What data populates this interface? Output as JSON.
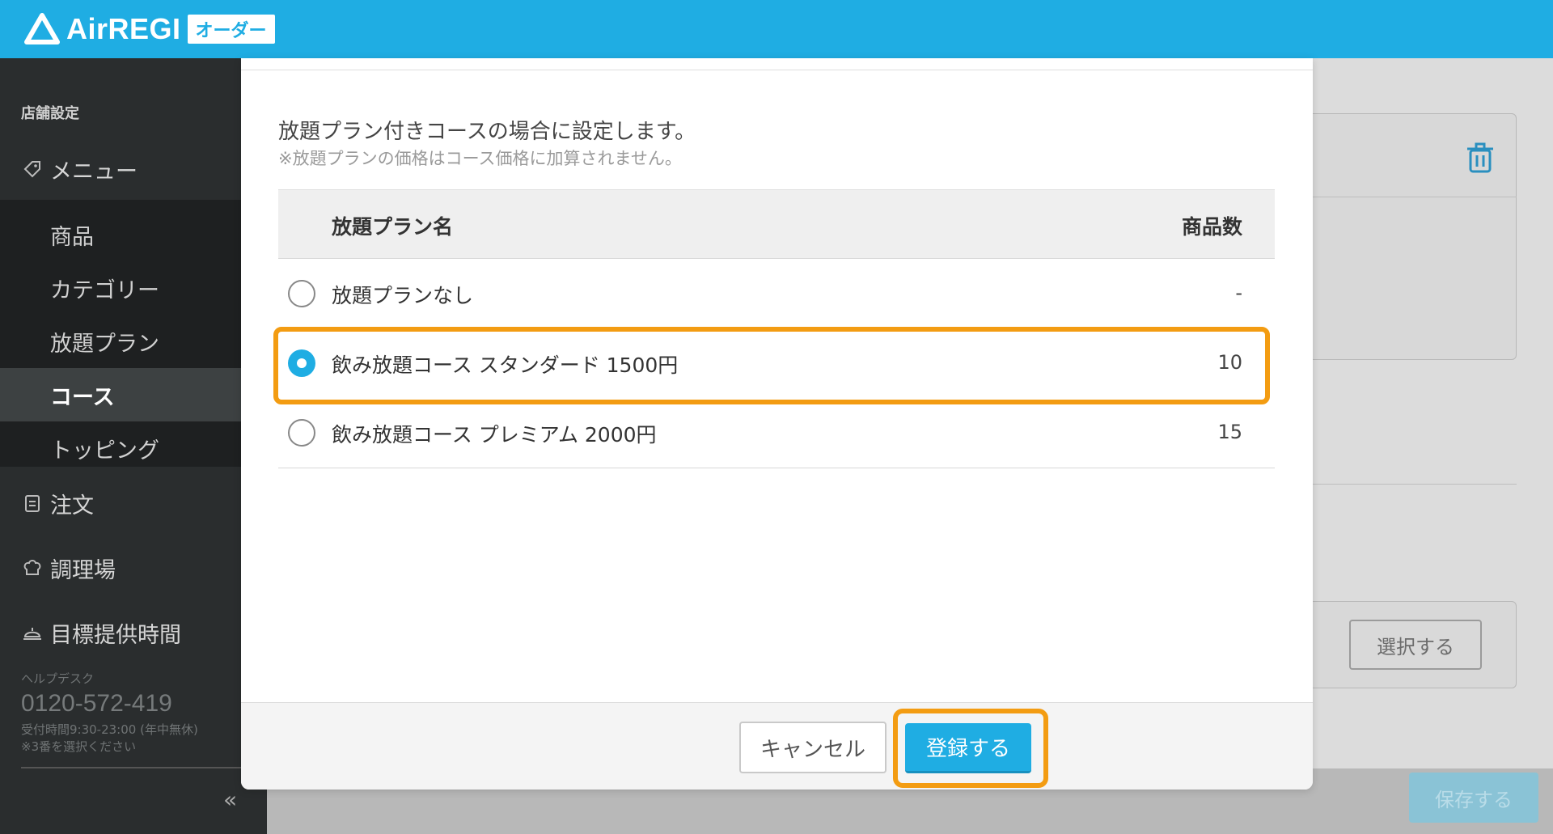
{
  "header": {
    "logo_text": "AirREGI",
    "logo_badge": "オーダー",
    "brand_color": "#1fade3"
  },
  "sidebar": {
    "section_title": "店舗設定",
    "menu": {
      "label": "メニュー",
      "icon": "tag-icon"
    },
    "submenu": [
      {
        "label": "商品"
      },
      {
        "label": "カテゴリー"
      },
      {
        "label": "放題プラン"
      },
      {
        "label": "コース",
        "active": true
      },
      {
        "label": "トッピング"
      }
    ],
    "order": {
      "label": "注文",
      "icon": "clipboard-icon"
    },
    "kitchen": {
      "label": "調理場",
      "icon": "chef-hat-icon"
    },
    "target_time": {
      "label": "目標提供時間",
      "icon": "service-bell-icon"
    },
    "help": {
      "title": "ヘルプデスク",
      "phone": "0120-572-419",
      "hours": "受付時間9:30-23:00 (年中無休)",
      "note": "※3番を選択ください"
    },
    "collapse_label": "«"
  },
  "background": {
    "select_button": "選択する",
    "save_button": "保存する"
  },
  "modal": {
    "description": "放題プラン付きコースの場合に設定します。",
    "note": "※放題プランの価格はコース価格に加算されません。",
    "table": {
      "col_name": "放題プラン名",
      "col_count": "商品数",
      "rows": [
        {
          "name": "放題プランなし",
          "count": "-",
          "selected": false
        },
        {
          "name": "飲み放題コース スタンダード 1500円",
          "count": "10",
          "selected": true
        },
        {
          "name": "飲み放題コース プレミアム 2000円",
          "count": "15",
          "selected": false
        }
      ]
    },
    "cancel_button": "キャンセル",
    "register_button": "登録する",
    "highlight_color": "#f39c12"
  }
}
